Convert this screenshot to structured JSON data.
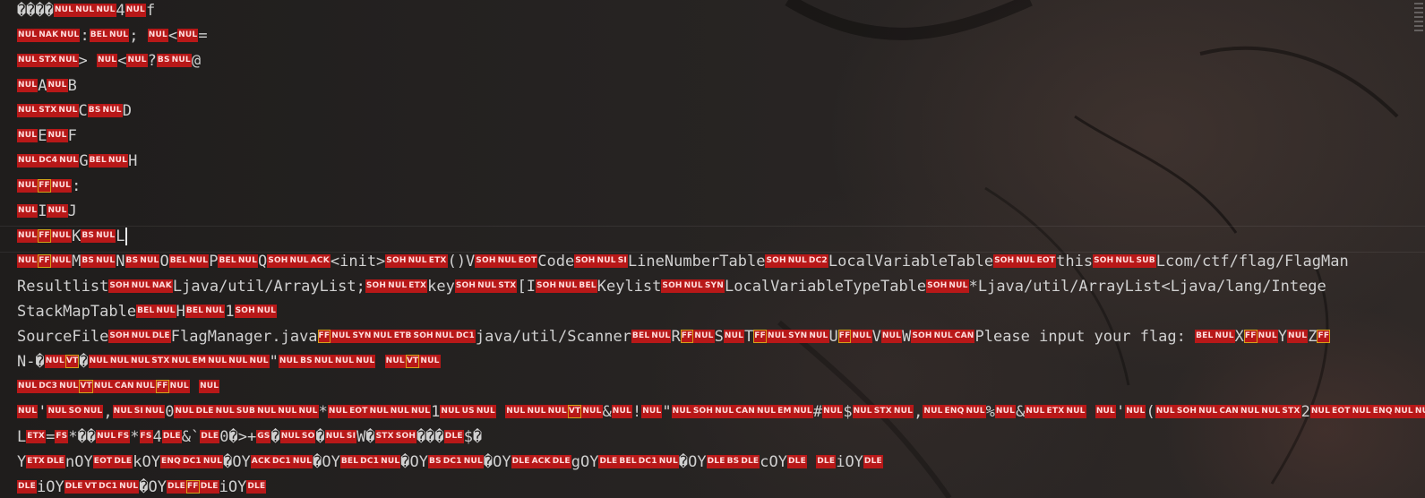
{
  "colors": {
    "control_bg": "#b81818",
    "text": "#d0d0d0",
    "highlight": "#d4a017"
  },
  "lines": [
    [
      [
        "t",
        "����"
      ],
      [
        "c",
        "NUL"
      ],
      [
        "c",
        "NUL"
      ],
      [
        "c",
        "NUL"
      ],
      [
        "t",
        "4"
      ],
      [
        "c",
        "NUL"
      ],
      [
        "t",
        "f"
      ]
    ],
    [
      [
        "c",
        "NUL"
      ],
      [
        "c",
        "NAK"
      ],
      [
        "c",
        "NUL"
      ],
      [
        "t",
        ":"
      ],
      [
        "c",
        "BEL"
      ],
      [
        "c",
        "NUL"
      ],
      [
        "t",
        ";  "
      ],
      [
        "c",
        "NUL"
      ],
      [
        "t",
        "<"
      ],
      [
        "c",
        "NUL"
      ],
      [
        "t",
        "="
      ]
    ],
    [
      [
        "c",
        "NUL"
      ],
      [
        "c",
        "STX"
      ],
      [
        "c",
        "NUL"
      ],
      [
        "t",
        ">      "
      ],
      [
        "c",
        "NUL"
      ],
      [
        "t",
        "<"
      ],
      [
        "c",
        "NUL"
      ],
      [
        "t",
        "?"
      ],
      [
        "c",
        "BS"
      ],
      [
        "c",
        "NUL"
      ],
      [
        "t",
        "@"
      ]
    ],
    [
      [
        "c",
        "NUL"
      ],
      [
        "t",
        "A"
      ],
      [
        "c",
        "NUL"
      ],
      [
        "t",
        "B"
      ]
    ],
    [
      [
        "c",
        "NUL"
      ],
      [
        "c",
        "STX"
      ],
      [
        "c",
        "NUL"
      ],
      [
        "t",
        "C"
      ],
      [
        "c",
        "BS"
      ],
      [
        "c",
        "NUL"
      ],
      [
        "t",
        "D"
      ]
    ],
    [
      [
        "c",
        "NUL"
      ],
      [
        "t",
        "E"
      ],
      [
        "c",
        "NUL"
      ],
      [
        "t",
        "F"
      ]
    ],
    [
      [
        "c",
        "NUL"
      ],
      [
        "c",
        "DC4"
      ],
      [
        "c",
        "NUL"
      ],
      [
        "t",
        "G"
      ],
      [
        "c",
        "BEL"
      ],
      [
        "c",
        "NUL"
      ],
      [
        "t",
        "H"
      ]
    ],
    [
      [
        "c",
        "NUL"
      ],
      [
        "s",
        "FF"
      ],
      [
        "c",
        "NUL"
      ],
      [
        "t",
        ":"
      ]
    ],
    [
      [
        "c",
        "NUL"
      ],
      [
        "t",
        "I"
      ],
      [
        "c",
        "NUL"
      ],
      [
        "t",
        "J"
      ]
    ],
    [
      [
        "c",
        "NUL"
      ],
      [
        "s",
        "FF"
      ],
      [
        "c",
        "NUL"
      ],
      [
        "t",
        "K"
      ],
      [
        "c",
        "BS"
      ],
      [
        "c",
        "NUL"
      ],
      [
        "t",
        "L"
      ]
    ],
    [
      [
        "c",
        "NUL"
      ],
      [
        "s",
        "FF"
      ],
      [
        "c",
        "NUL"
      ],
      [
        "t",
        "M"
      ],
      [
        "c",
        "BS"
      ],
      [
        "c",
        "NUL"
      ],
      [
        "t",
        "N"
      ],
      [
        "c",
        "BS"
      ],
      [
        "c",
        "NUL"
      ],
      [
        "t",
        "O"
      ],
      [
        "c",
        "BEL"
      ],
      [
        "c",
        "NUL"
      ],
      [
        "t",
        "P"
      ],
      [
        "c",
        "BEL"
      ],
      [
        "c",
        "NUL"
      ],
      [
        "t",
        "Q"
      ],
      [
        "c",
        "SOH"
      ],
      [
        "c",
        "NUL"
      ],
      [
        "c",
        "ACK"
      ],
      [
        "t",
        "<init>"
      ],
      [
        "c",
        "SOH"
      ],
      [
        "c",
        "NUL"
      ],
      [
        "c",
        "ETX"
      ],
      [
        "t",
        "()V"
      ],
      [
        "c",
        "SOH"
      ],
      [
        "c",
        "NUL"
      ],
      [
        "c",
        "EOT"
      ],
      [
        "t",
        "Code"
      ],
      [
        "c",
        "SOH"
      ],
      [
        "c",
        "NUL"
      ],
      [
        "c",
        "SI"
      ],
      [
        "t",
        "LineNumberTable"
      ],
      [
        "c",
        "SOH"
      ],
      [
        "c",
        "NUL"
      ],
      [
        "c",
        "DC2"
      ],
      [
        "t",
        "LocalVariableTable"
      ],
      [
        "c",
        "SOH"
      ],
      [
        "c",
        "NUL"
      ],
      [
        "c",
        "EOT"
      ],
      [
        "t",
        "this"
      ],
      [
        "c",
        "SOH"
      ],
      [
        "c",
        "NUL"
      ],
      [
        "c",
        "SUB"
      ],
      [
        "t",
        "Lcom/ctf/flag/FlagMan"
      ]
    ],
    [
      [
        "t",
        "Resultlist"
      ],
      [
        "c",
        "SOH"
      ],
      [
        "c",
        "NUL"
      ],
      [
        "c",
        "NAK"
      ],
      [
        "t",
        "Ljava/util/ArrayList;"
      ],
      [
        "c",
        "SOH"
      ],
      [
        "c",
        "NUL"
      ],
      [
        "c",
        "ETX"
      ],
      [
        "t",
        "key"
      ],
      [
        "c",
        "SOH"
      ],
      [
        "c",
        "NUL"
      ],
      [
        "c",
        "STX"
      ],
      [
        "t",
        "[I"
      ],
      [
        "c",
        "SOH"
      ],
      [
        "c",
        "NUL"
      ],
      [
        "c",
        "BEL"
      ],
      [
        "t",
        "Keylist"
      ],
      [
        "c",
        "SOH"
      ],
      [
        "c",
        "NUL"
      ],
      [
        "c",
        "SYN"
      ],
      [
        "t",
        "LocalVariableTypeTable"
      ],
      [
        "c",
        "SOH"
      ],
      [
        "c",
        "NUL"
      ],
      [
        "t",
        "*Ljava/util/ArrayList<Ljava/lang/Intege"
      ]
    ],
    [
      [
        "t",
        "StackMapTable"
      ],
      [
        "c",
        "BEL"
      ],
      [
        "c",
        "NUL"
      ],
      [
        "t",
        "H"
      ],
      [
        "c",
        "BEL"
      ],
      [
        "c",
        "NUL"
      ],
      [
        "t",
        "1"
      ],
      [
        "c",
        "SOH"
      ],
      [
        "c",
        "NUL"
      ]
    ],
    [
      [
        "t",
        "SourceFile"
      ],
      [
        "c",
        "SOH"
      ],
      [
        "c",
        "NUL"
      ],
      [
        "c",
        "DLE"
      ],
      [
        "t",
        "FlagManager.java"
      ],
      [
        "s",
        "FF"
      ],
      [
        "c",
        "NUL"
      ],
      [
        "c",
        "SYN"
      ],
      [
        "c",
        "NUL"
      ],
      [
        "c",
        "ETB"
      ],
      [
        "c",
        "SOH"
      ],
      [
        "c",
        "NUL"
      ],
      [
        "c",
        "DC1"
      ],
      [
        "t",
        "java/util/Scanner"
      ],
      [
        "c",
        "BEL"
      ],
      [
        "c",
        "NUL"
      ],
      [
        "t",
        "R"
      ],
      [
        "s",
        "FF"
      ],
      [
        "c",
        "NUL"
      ],
      [
        "t",
        "S"
      ],
      [
        "c",
        "NUL"
      ],
      [
        "t",
        "T"
      ],
      [
        "s",
        "FF"
      ],
      [
        "c",
        "NUL"
      ],
      [
        "c",
        "SYN"
      ],
      [
        "c",
        "NUL"
      ],
      [
        "t",
        "U"
      ],
      [
        "s",
        "FF"
      ],
      [
        "c",
        "NUL"
      ],
      [
        "t",
        "V"
      ],
      [
        "c",
        "NUL"
      ],
      [
        "t",
        "W"
      ],
      [
        "c",
        "SOH"
      ],
      [
        "c",
        "NUL"
      ],
      [
        "c",
        "CAN"
      ],
      [
        "t",
        "Please input your flag: "
      ],
      [
        "c",
        "BEL"
      ],
      [
        "c",
        "NUL"
      ],
      [
        "t",
        "X"
      ],
      [
        "s",
        "FF"
      ],
      [
        "c",
        "NUL"
      ],
      [
        "t",
        "Y"
      ],
      [
        "c",
        "NUL"
      ],
      [
        "t",
        "Z"
      ],
      [
        "s",
        "FF"
      ]
    ],
    [
      [
        "t",
        "N-�"
      ],
      [
        "c",
        "NUL"
      ],
      [
        "s",
        "VT"
      ],
      [
        "t",
        "�"
      ],
      [
        "c",
        "NUL"
      ],
      [
        "c",
        "NUL"
      ],
      [
        "c",
        "NUL"
      ],
      [
        "c",
        "STX"
      ],
      [
        "c",
        "NUL"
      ],
      [
        "c",
        "EM"
      ],
      [
        "c",
        "NUL"
      ],
      [
        "c",
        "NUL"
      ],
      [
        "c",
        "NUL"
      ],
      [
        "t",
        "\""
      ],
      [
        "c",
        "NUL"
      ],
      [
        "c",
        "BS"
      ],
      [
        "c",
        "NUL"
      ],
      [
        "c",
        "NUL"
      ],
      [
        "c",
        "NUL"
      ],
      [
        "t",
        "     "
      ],
      [
        "c",
        "NUL"
      ],
      [
        "s",
        "VT"
      ],
      [
        "c",
        "NUL"
      ]
    ],
    [
      [
        "c",
        "NUL"
      ],
      [
        "c",
        "DC3"
      ],
      [
        "c",
        "NUL"
      ],
      [
        "s",
        "VT"
      ],
      [
        "c",
        "NUL"
      ],
      [
        "c",
        "CAN"
      ],
      [
        "c",
        "NUL"
      ],
      [
        "s",
        "FF"
      ],
      [
        "c",
        "NUL"
      ],
      [
        "t",
        "  "
      ],
      [
        "c",
        "NUL"
      ]
    ],
    [
      [
        "c",
        "NUL"
      ],
      [
        "t",
        "'"
      ],
      [
        "c",
        "NUL"
      ],
      [
        "c",
        "SO"
      ],
      [
        "c",
        "NUL"
      ],
      [
        "t",
        ","
      ],
      [
        "c",
        "NUL"
      ],
      [
        "c",
        "SI"
      ],
      [
        "c",
        "NUL"
      ],
      [
        "t",
        "0"
      ],
      [
        "c",
        "NUL"
      ],
      [
        "c",
        "DLE"
      ],
      [
        "c",
        "NUL"
      ],
      [
        "c",
        "SUB"
      ],
      [
        "c",
        "NUL"
      ],
      [
        "c",
        "NUL"
      ],
      [
        "c",
        "NUL"
      ],
      [
        "t",
        "*"
      ],
      [
        "c",
        "NUL"
      ],
      [
        "c",
        "EOT"
      ],
      [
        "c",
        "NUL"
      ],
      [
        "c",
        "NUL"
      ],
      [
        "c",
        "NUL"
      ],
      [
        "t",
        "1"
      ],
      [
        "c",
        "NUL"
      ],
      [
        "c",
        "US"
      ],
      [
        "c",
        "NUL"
      ],
      [
        "t",
        "  "
      ],
      [
        "c",
        "NUL"
      ],
      [
        "c",
        "NUL"
      ],
      [
        "c",
        "NUL"
      ],
      [
        "s",
        "VT"
      ],
      [
        "c",
        "NUL"
      ],
      [
        "t",
        "&"
      ],
      [
        "c",
        "NUL"
      ],
      [
        "t",
        "!"
      ],
      [
        "c",
        "NUL"
      ],
      [
        "t",
        "\""
      ],
      [
        "c",
        "NUL"
      ],
      [
        "c",
        "SOH"
      ],
      [
        "c",
        "NUL"
      ],
      [
        "c",
        "CAN"
      ],
      [
        "c",
        "NUL"
      ],
      [
        "c",
        "EM"
      ],
      [
        "c",
        "NUL"
      ],
      [
        "t",
        "#"
      ],
      [
        "c",
        "NUL"
      ],
      [
        "t",
        "$"
      ],
      [
        "c",
        "NUL"
      ],
      [
        "c",
        "STX"
      ],
      [
        "c",
        "NUL"
      ],
      [
        "t",
        ","
      ],
      [
        "c",
        "NUL"
      ],
      [
        "c",
        "ENQ"
      ],
      [
        "c",
        "NUL"
      ],
      [
        "t",
        "%"
      ],
      [
        "c",
        "NUL"
      ],
      [
        "t",
        "&"
      ],
      [
        "c",
        "NUL"
      ],
      [
        "c",
        "ETX"
      ],
      [
        "c",
        "NUL"
      ],
      [
        "t",
        "    "
      ],
      [
        "c",
        "NUL"
      ],
      [
        "t",
        "'"
      ],
      [
        "c",
        "NUL"
      ],
      [
        "t",
        "("
      ],
      [
        "c",
        "NUL"
      ],
      [
        "c",
        "SOH"
      ],
      [
        "c",
        "NUL"
      ],
      [
        "c",
        "CAN"
      ],
      [
        "c",
        "NUL"
      ],
      [
        "c",
        "NUL"
      ],
      [
        "c",
        "STX"
      ],
      [
        "t",
        "2"
      ],
      [
        "c",
        "NUL"
      ],
      [
        "c",
        "EOT"
      ],
      [
        "c",
        "NUL"
      ],
      [
        "c",
        "ENQ"
      ],
      [
        "c",
        "NUL"
      ],
      [
        "c",
        "NUL"
      ],
      [
        "c",
        "SOH"
      ]
    ],
    [
      [
        "t",
        "L"
      ],
      [
        "c",
        "ETX"
      ],
      [
        "t",
        "="
      ],
      [
        "c",
        "FS"
      ],
      [
        "t",
        "*��"
      ],
      [
        "c",
        "NUL"
      ],
      [
        "c",
        "FS"
      ],
      [
        "t",
        "*"
      ],
      [
        "c",
        "FS"
      ],
      [
        "t",
        "4"
      ],
      [
        "c",
        "DLE"
      ],
      [
        "t",
        "&`"
      ],
      [
        "c",
        "DLE"
      ],
      [
        "t",
        "0�>+"
      ],
      [
        "c",
        "GS"
      ],
      [
        "t",
        "�"
      ],
      [
        "c",
        "NUL"
      ],
      [
        "c",
        "SO"
      ],
      [
        "t",
        "�"
      ],
      [
        "c",
        "NUL"
      ],
      [
        "c",
        "SI"
      ],
      [
        "t",
        "W�"
      ],
      [
        "c",
        "STX"
      ],
      [
        "c",
        "SOH"
      ],
      [
        "t",
        "���"
      ],
      [
        "c",
        "DLE"
      ],
      [
        "t",
        "$�"
      ]
    ],
    [
      [
        "t",
        "Y"
      ],
      [
        "c",
        "ETX"
      ],
      [
        "c",
        "DLE"
      ],
      [
        "t",
        "nOY"
      ],
      [
        "c",
        "EOT"
      ],
      [
        "c",
        "DLE"
      ],
      [
        "t",
        "kOY"
      ],
      [
        "c",
        "ENQ"
      ],
      [
        "c",
        "DC1"
      ],
      [
        "c",
        "NUL"
      ],
      [
        "t",
        "�OY"
      ],
      [
        "c",
        "ACK"
      ],
      [
        "c",
        "DC1"
      ],
      [
        "c",
        "NUL"
      ],
      [
        "t",
        "�OY"
      ],
      [
        "c",
        "BEL"
      ],
      [
        "c",
        "DC1"
      ],
      [
        "c",
        "NUL"
      ],
      [
        "t",
        "�OY"
      ],
      [
        "c",
        "BS"
      ],
      [
        "c",
        "DC1"
      ],
      [
        "c",
        "NUL"
      ],
      [
        "t",
        "�OY"
      ],
      [
        "c",
        "DLE"
      ],
      [
        "c",
        "ACK"
      ],
      [
        "c",
        "DLE"
      ],
      [
        "t",
        "gOY"
      ],
      [
        "c",
        "DLE"
      ],
      [
        "c",
        "BEL"
      ],
      [
        "c",
        "DC1"
      ],
      [
        "c",
        "NUL"
      ],
      [
        "t",
        "�OY"
      ],
      [
        "c",
        "DLE"
      ],
      [
        "c",
        "BS"
      ],
      [
        "c",
        "DLE"
      ],
      [
        "t",
        "cOY"
      ],
      [
        "c",
        "DLE"
      ],
      [
        "t",
        "  "
      ],
      [
        "c",
        "DLE"
      ],
      [
        "t",
        "iOY"
      ],
      [
        "c",
        "DLE"
      ]
    ],
    [
      [
        "c",
        "DLE"
      ],
      [
        "t",
        "iOY"
      ],
      [
        "c",
        "DLE"
      ],
      [
        "c",
        "VT"
      ],
      [
        "c",
        "DC1"
      ],
      [
        "c",
        "NUL"
      ],
      [
        "t",
        "�OY"
      ],
      [
        "c",
        "DLE"
      ],
      [
        "s",
        "FF"
      ],
      [
        "c",
        "DLE"
      ],
      [
        "t",
        "iOY"
      ],
      [
        "c",
        "DLE"
      ]
    ]
  ]
}
